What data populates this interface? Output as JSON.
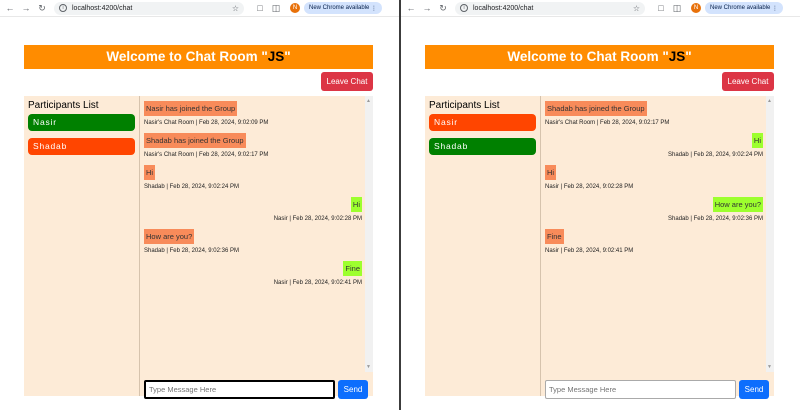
{
  "browser": {
    "url": "localhost:4200/chat",
    "profile_initial": "N",
    "update_label": "New Chrome available"
  },
  "header": {
    "prefix": "Welcome to Chat Room \"",
    "room": "JS",
    "suffix": "\""
  },
  "leave_label": "Leave Chat",
  "participants_title": "Participants List",
  "input_placeholder": "Type Message Here",
  "send_label": "Send",
  "left_window": {
    "participants": [
      {
        "name": "Nasir",
        "color": "green"
      },
      {
        "name": "Shadab",
        "color": "orange"
      }
    ],
    "messages": [
      {
        "side": "left",
        "text": "Nasir has joined the Group",
        "meta": "Nasir's Chat Room | Feb 28, 2024, 9:02:09 PM"
      },
      {
        "side": "left",
        "text": "Shadab has joined the Group",
        "meta": "Nasir's Chat Room | Feb 28, 2024, 9:02:17 PM"
      },
      {
        "side": "left",
        "text": "Hi",
        "meta": "Shadab | Feb 28, 2024, 9:02:24 PM"
      },
      {
        "side": "right",
        "text": "Hi",
        "meta": "Nasir | Feb 28, 2024, 9:02:28 PM"
      },
      {
        "side": "left",
        "text": "How are you?",
        "meta": "Shadab | Feb 28, 2024, 9:02:36 PM"
      },
      {
        "side": "right",
        "text": "Fine",
        "meta": "Nasir | Feb 28, 2024, 9:02:41 PM"
      }
    ]
  },
  "right_window": {
    "participants": [
      {
        "name": "Nasir",
        "color": "orange"
      },
      {
        "name": "Shadab",
        "color": "green"
      }
    ],
    "messages": [
      {
        "side": "left",
        "text": "Shadab has joined the Group",
        "meta": "Nasir's Chat Room | Feb 28, 2024, 9:02:17 PM"
      },
      {
        "side": "right",
        "text": "Hi",
        "meta": "Shadab | Feb 28, 2024, 9:02:24 PM"
      },
      {
        "side": "left",
        "text": "Hi",
        "meta": "Nasir | Feb 28, 2024, 9:02:28 PM"
      },
      {
        "side": "right",
        "text": "How are you?",
        "meta": "Shadab | Feb 28, 2024, 9:02:36 PM"
      },
      {
        "side": "left",
        "text": "Fine",
        "meta": "Nasir | Feb 28, 2024, 9:02:41 PM"
      }
    ]
  },
  "colors": {
    "header_bg": "#ff8c00",
    "chat_bg": "#fdebd7",
    "left_bubble": "#f88b5a",
    "right_bubble": "#9dff2e",
    "leave_bg": "#dc3545",
    "send_bg": "#0d6efd"
  }
}
